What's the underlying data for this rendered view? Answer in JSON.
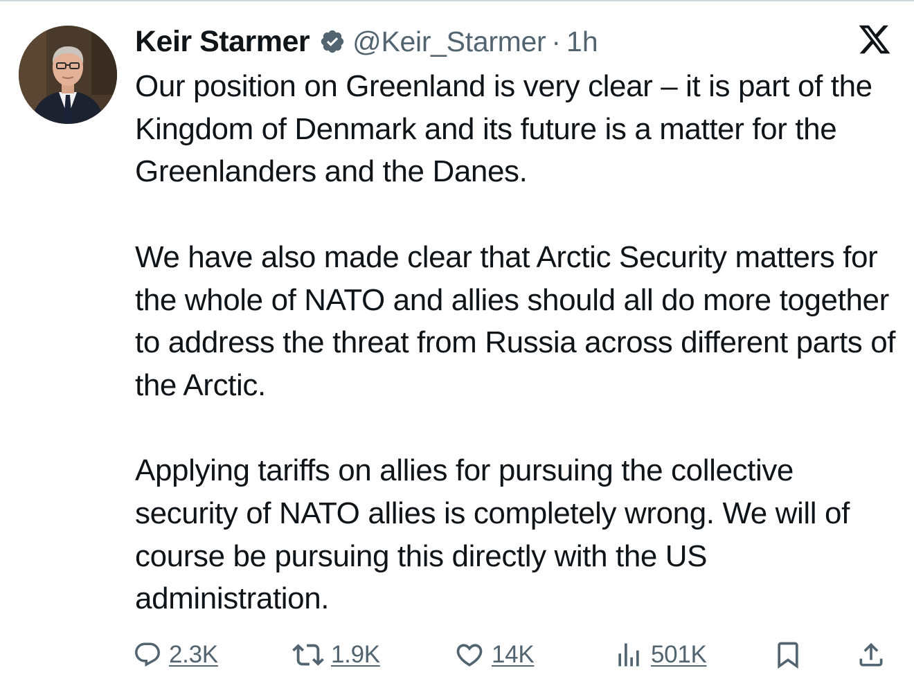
{
  "tweet": {
    "author_name": "Keir Starmer",
    "handle": "@Keir_Starmer",
    "separator": "·",
    "time": "1h",
    "verified": true,
    "paragraphs": [
      "Our position on Greenland is very clear – it is part of the Kingdom of Denmark and its future is a matter for the Greenlanders and the Danes.",
      "We have also made clear that Arctic Security matters for the whole of NATO and allies should all do more together to address the threat from Russia across different parts of the Arctic.",
      "Applying tariffs on allies for pursuing the collective security of NATO allies is completely wrong. We will of course be pursuing this directly with the US administration."
    ]
  },
  "actions": {
    "replies": "2.3K",
    "reposts": "1.9K",
    "likes": "14K",
    "views": "501K"
  },
  "icons": {
    "verified": "verified-badge-icon",
    "brand": "x-logo-icon",
    "reply": "reply-icon",
    "repost": "repost-icon",
    "like": "heart-icon",
    "views": "views-chart-icon",
    "bookmark": "bookmark-icon",
    "share": "share-icon"
  },
  "colors": {
    "text": "#0f1419",
    "secondary": "#536471",
    "verified_badge": "#536471"
  }
}
